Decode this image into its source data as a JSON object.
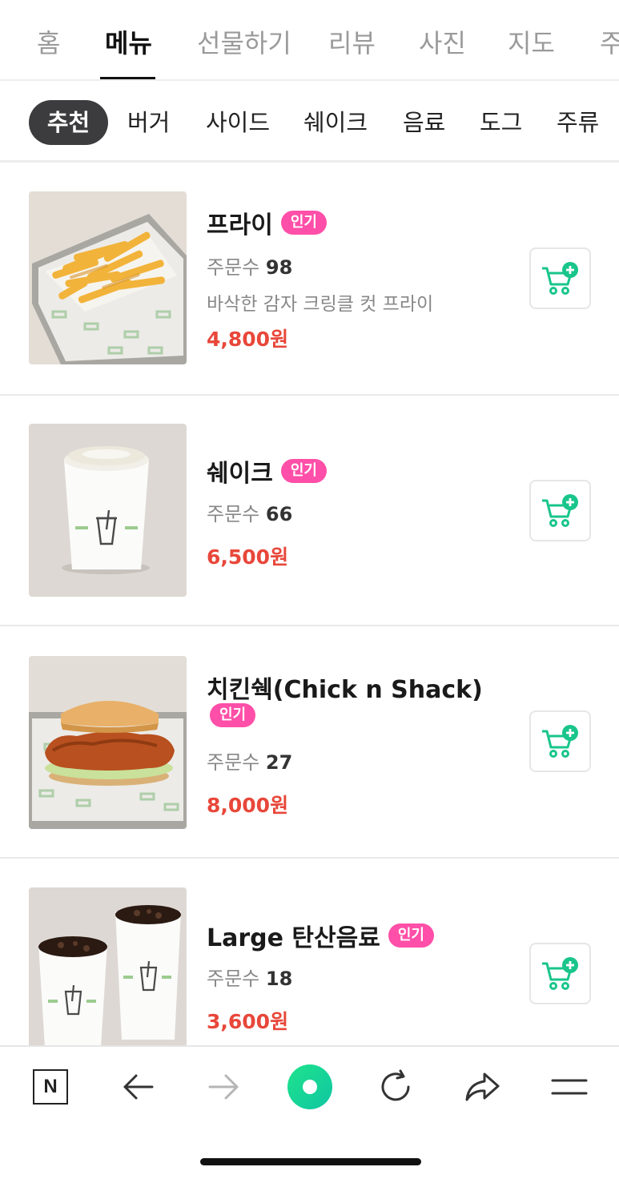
{
  "top_tabs": [
    {
      "label": "홈",
      "active": false
    },
    {
      "label": "메뉴",
      "active": true
    },
    {
      "label": "선물하기",
      "active": false
    },
    {
      "label": "리뷰",
      "active": false
    },
    {
      "label": "사진",
      "active": false
    },
    {
      "label": "지도",
      "active": false
    },
    {
      "label": "주",
      "active": false
    }
  ],
  "categories": [
    {
      "label": "추천",
      "active": true
    },
    {
      "label": "버거",
      "active": false
    },
    {
      "label": "사이드",
      "active": false
    },
    {
      "label": "쉐이크",
      "active": false
    },
    {
      "label": "음료",
      "active": false
    },
    {
      "label": "도그",
      "active": false
    },
    {
      "label": "주류",
      "active": false
    }
  ],
  "menu_items": [
    {
      "name": "프라이",
      "badge": "인기",
      "order_label": "주문수",
      "order_count": "98",
      "description": "바삭한 감자 크링클 컷 프라이",
      "price": "4,800원",
      "image": "fries-image"
    },
    {
      "name": "쉐이크",
      "badge": "인기",
      "order_label": "주문수",
      "order_count": "66",
      "description": "",
      "price": "6,500원",
      "image": "shake-image"
    },
    {
      "name": "치킨쉑(Chick n Shack)",
      "badge": "인기",
      "order_label": "주문수",
      "order_count": "27",
      "description": "",
      "price": "8,000원",
      "image": "chicken-burger-image"
    },
    {
      "name": "Large 탄산음료",
      "badge": "인기",
      "order_label": "주문수",
      "order_count": "18",
      "description": "",
      "price": "3,600원",
      "image": "soda-image"
    }
  ],
  "bottom_nav": {
    "logo_text": "N",
    "icons": [
      "naver-logo-icon",
      "back-arrow-icon",
      "forward-arrow-icon",
      "green-dot-icon",
      "refresh-icon",
      "share-icon",
      "menu-icon"
    ]
  },
  "colors": {
    "price": "#e8473a",
    "badge": "#ff4fa8",
    "cart_green": "#19c58b",
    "active_chip": "#3c3c3e"
  }
}
